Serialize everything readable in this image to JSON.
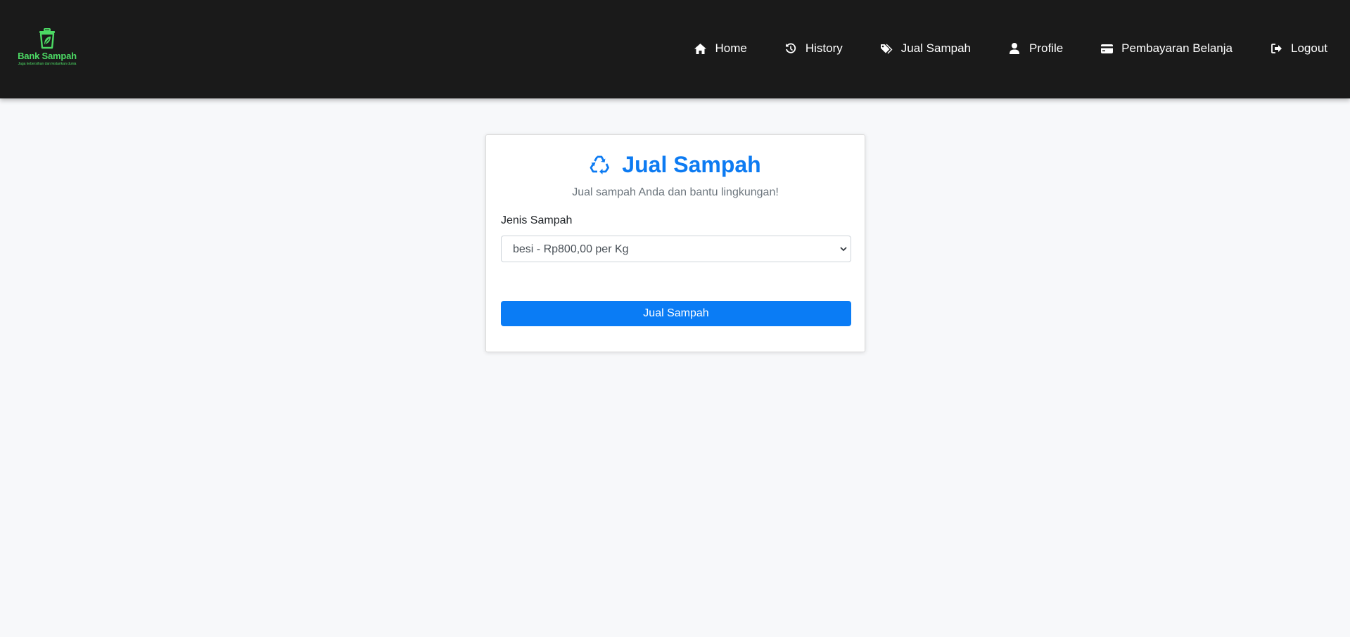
{
  "brand": {
    "name": "Bank Sampah",
    "tagline": "Jaga kebersihan dan lestarikan dunia",
    "logo_icon": "trash-leaf-icon",
    "color": "#4cd964"
  },
  "nav": {
    "items": [
      {
        "label": "Home",
        "icon": "home-icon"
      },
      {
        "label": "History",
        "icon": "history-icon"
      },
      {
        "label": "Jual Sampah",
        "icon": "tags-icon"
      },
      {
        "label": "Profile",
        "icon": "user-icon"
      },
      {
        "label": "Pembayaran Belanja",
        "icon": "credit-card-icon"
      },
      {
        "label": "Logout",
        "icon": "logout-icon"
      }
    ]
  },
  "form": {
    "title": "Jual Sampah",
    "title_icon": "recycle-icon",
    "subtitle": "Jual sampah Anda dan bantu lingkungan!",
    "field_label": "Jenis Sampah",
    "selected_option": "besi - Rp800,00 per Kg",
    "submit_label": "Jual Sampah"
  },
  "colors": {
    "navbar_bg": "#1a1a1a",
    "accent": "#0a7cf5",
    "page_bg": "#f7f8fa"
  }
}
